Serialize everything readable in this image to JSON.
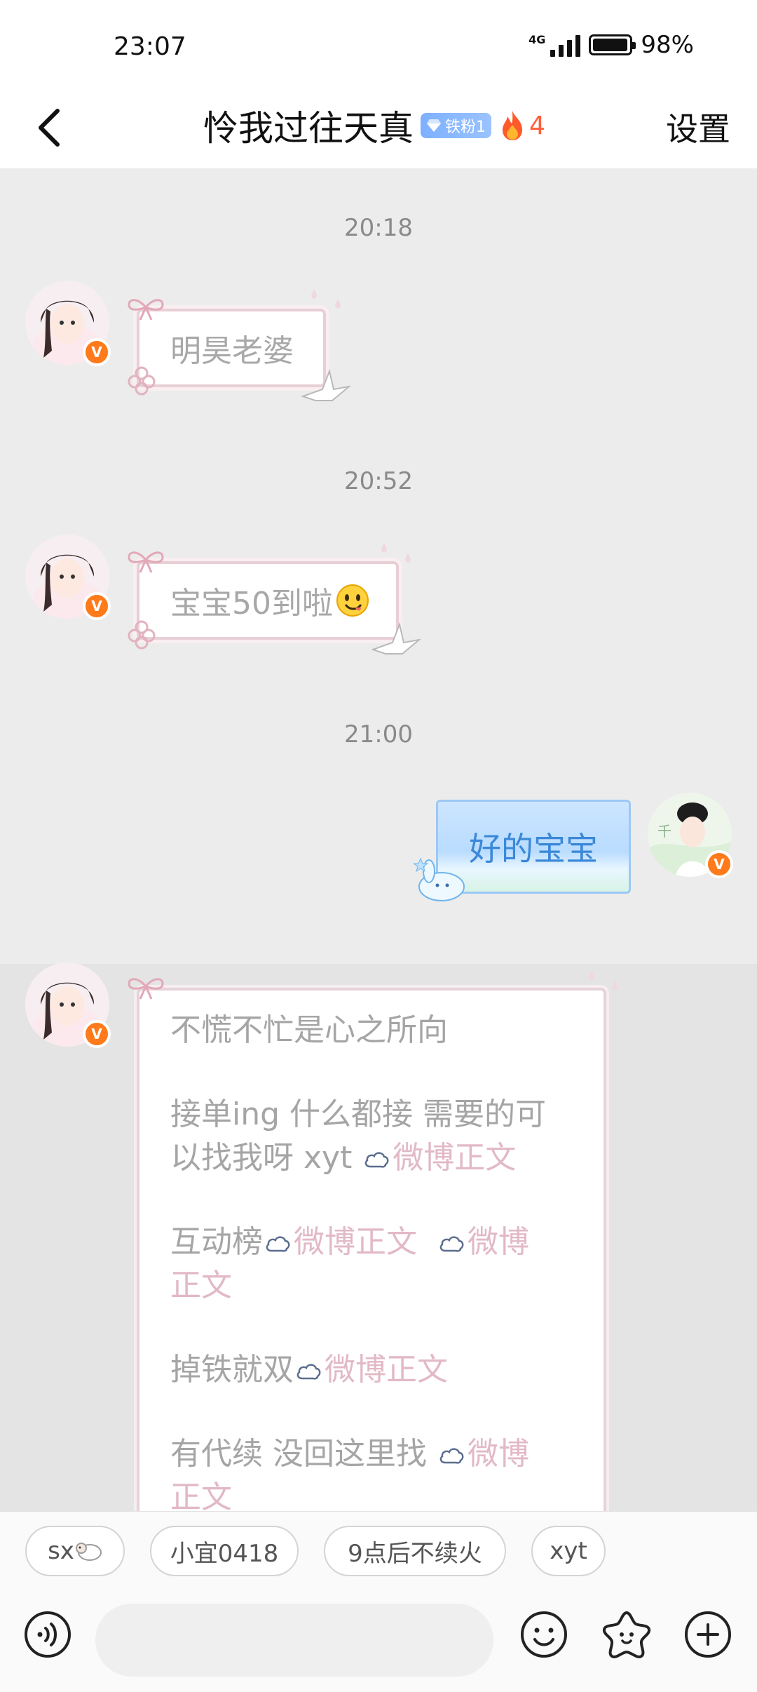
{
  "status_bar": {
    "time": "23:07",
    "network": "4G",
    "battery": "98%",
    "battery_level": 0.98
  },
  "header": {
    "title": "怜我过往天真",
    "fan_badge": "铁粉1",
    "fire_count": "4",
    "settings_label": "设置"
  },
  "messages": [
    {
      "time": "20:18",
      "sender": "other",
      "text": "明昊老婆"
    },
    {
      "time": "20:52",
      "sender": "other",
      "text": "宝宝50到啦"
    },
    {
      "time": "21:00",
      "sender": "self",
      "text": "好的宝宝"
    }
  ],
  "pinned_message": {
    "line1": "不慌不忙是心之所向",
    "line2a": "接单ing 什么都接 需要的可",
    "line2b": "以找我呀 xyt ",
    "line3": "互动榜",
    "line4": "掉铁就双",
    "line5": "有代续 没回这里找 ",
    "link_text": "微博正文",
    "link_split_a": "微博",
    "link_split_b": "正文"
  },
  "quick_replies": [
    "sx",
    "小宜0418",
    "9点后不续火",
    "xyt"
  ],
  "input": {
    "placeholder": ""
  },
  "icons": [
    "back-arrow-icon",
    "fire-icon",
    "diamond-icon",
    "voice-icon",
    "emoji-icon",
    "sticker-icon",
    "add-icon",
    "cloud-icon",
    "sheep-emoji-icon"
  ],
  "colors": {
    "accent_orange": "#ff7a1a",
    "fire_red": "#ff5e3a",
    "link_pink": "#e2b9c6",
    "blue_bubble_text": "#3b88d8"
  }
}
